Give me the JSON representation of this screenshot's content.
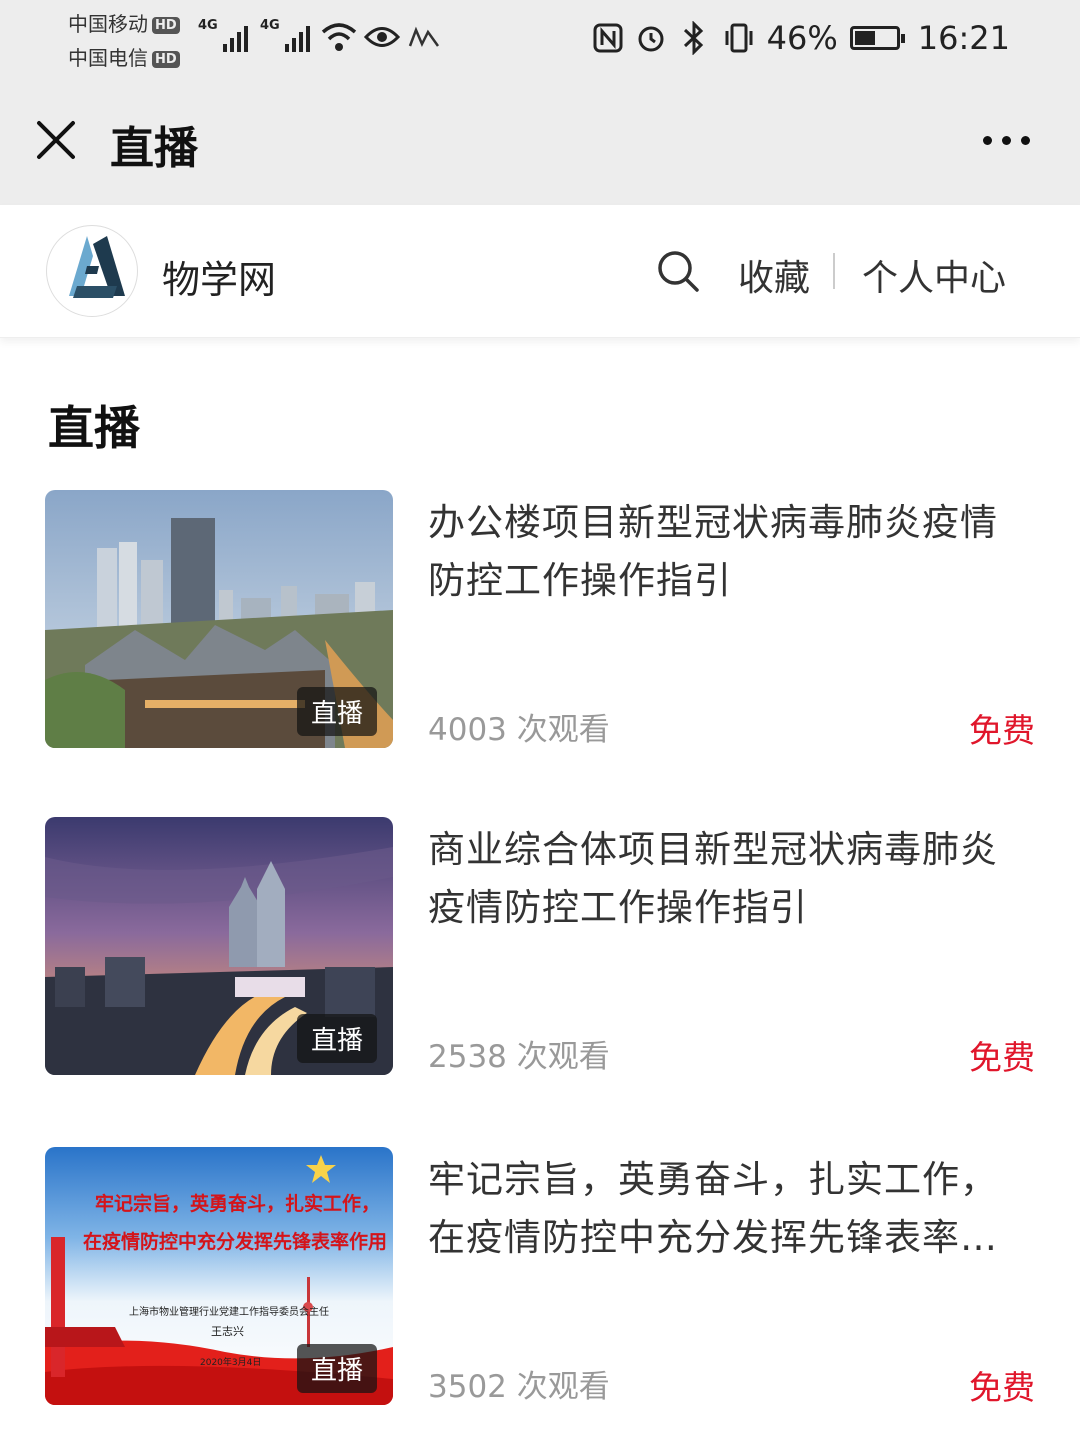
{
  "status_bar": {
    "carrier1": "中国移动",
    "carrier2": "中国电信",
    "hd_badge": "HD",
    "network1": "4G",
    "network2": "4G",
    "battery_percent": "46%",
    "time": "16:21"
  },
  "titlebar": {
    "title": "直播"
  },
  "site": {
    "name": "物学网",
    "nav": {
      "favorites": "收藏",
      "profile": "个人中心"
    }
  },
  "section": {
    "title": "直播"
  },
  "items": [
    {
      "title": "办公楼项目新型冠状病毒肺炎疫情防控工作操作指引",
      "views": "4003 次观看",
      "price": "免费",
      "badge": "直播"
    },
    {
      "title": "商业综合体项目新型冠状病毒肺炎疫情防控工作操作指引",
      "views": "2538 次观看",
      "price": "免费",
      "badge": "直播"
    },
    {
      "title": "牢记宗旨，英勇奋斗，扎实工作，在疫情防控中充分发挥先锋表率作用",
      "views": "3502 次观看",
      "price": "免费",
      "badge": "直播",
      "poster": {
        "line1": "牢记宗旨，英勇奋斗，扎实工作，",
        "line2": "在疫情防控中充分发挥先锋表率作用",
        "org": "上海市物业管理行业党建工作指导委员会主任",
        "person": "王志兴",
        "date": "2020年3月4日"
      }
    }
  ],
  "colors": {
    "price": "#e0162b",
    "bar_bg": "#ededed",
    "views": "#999999"
  }
}
